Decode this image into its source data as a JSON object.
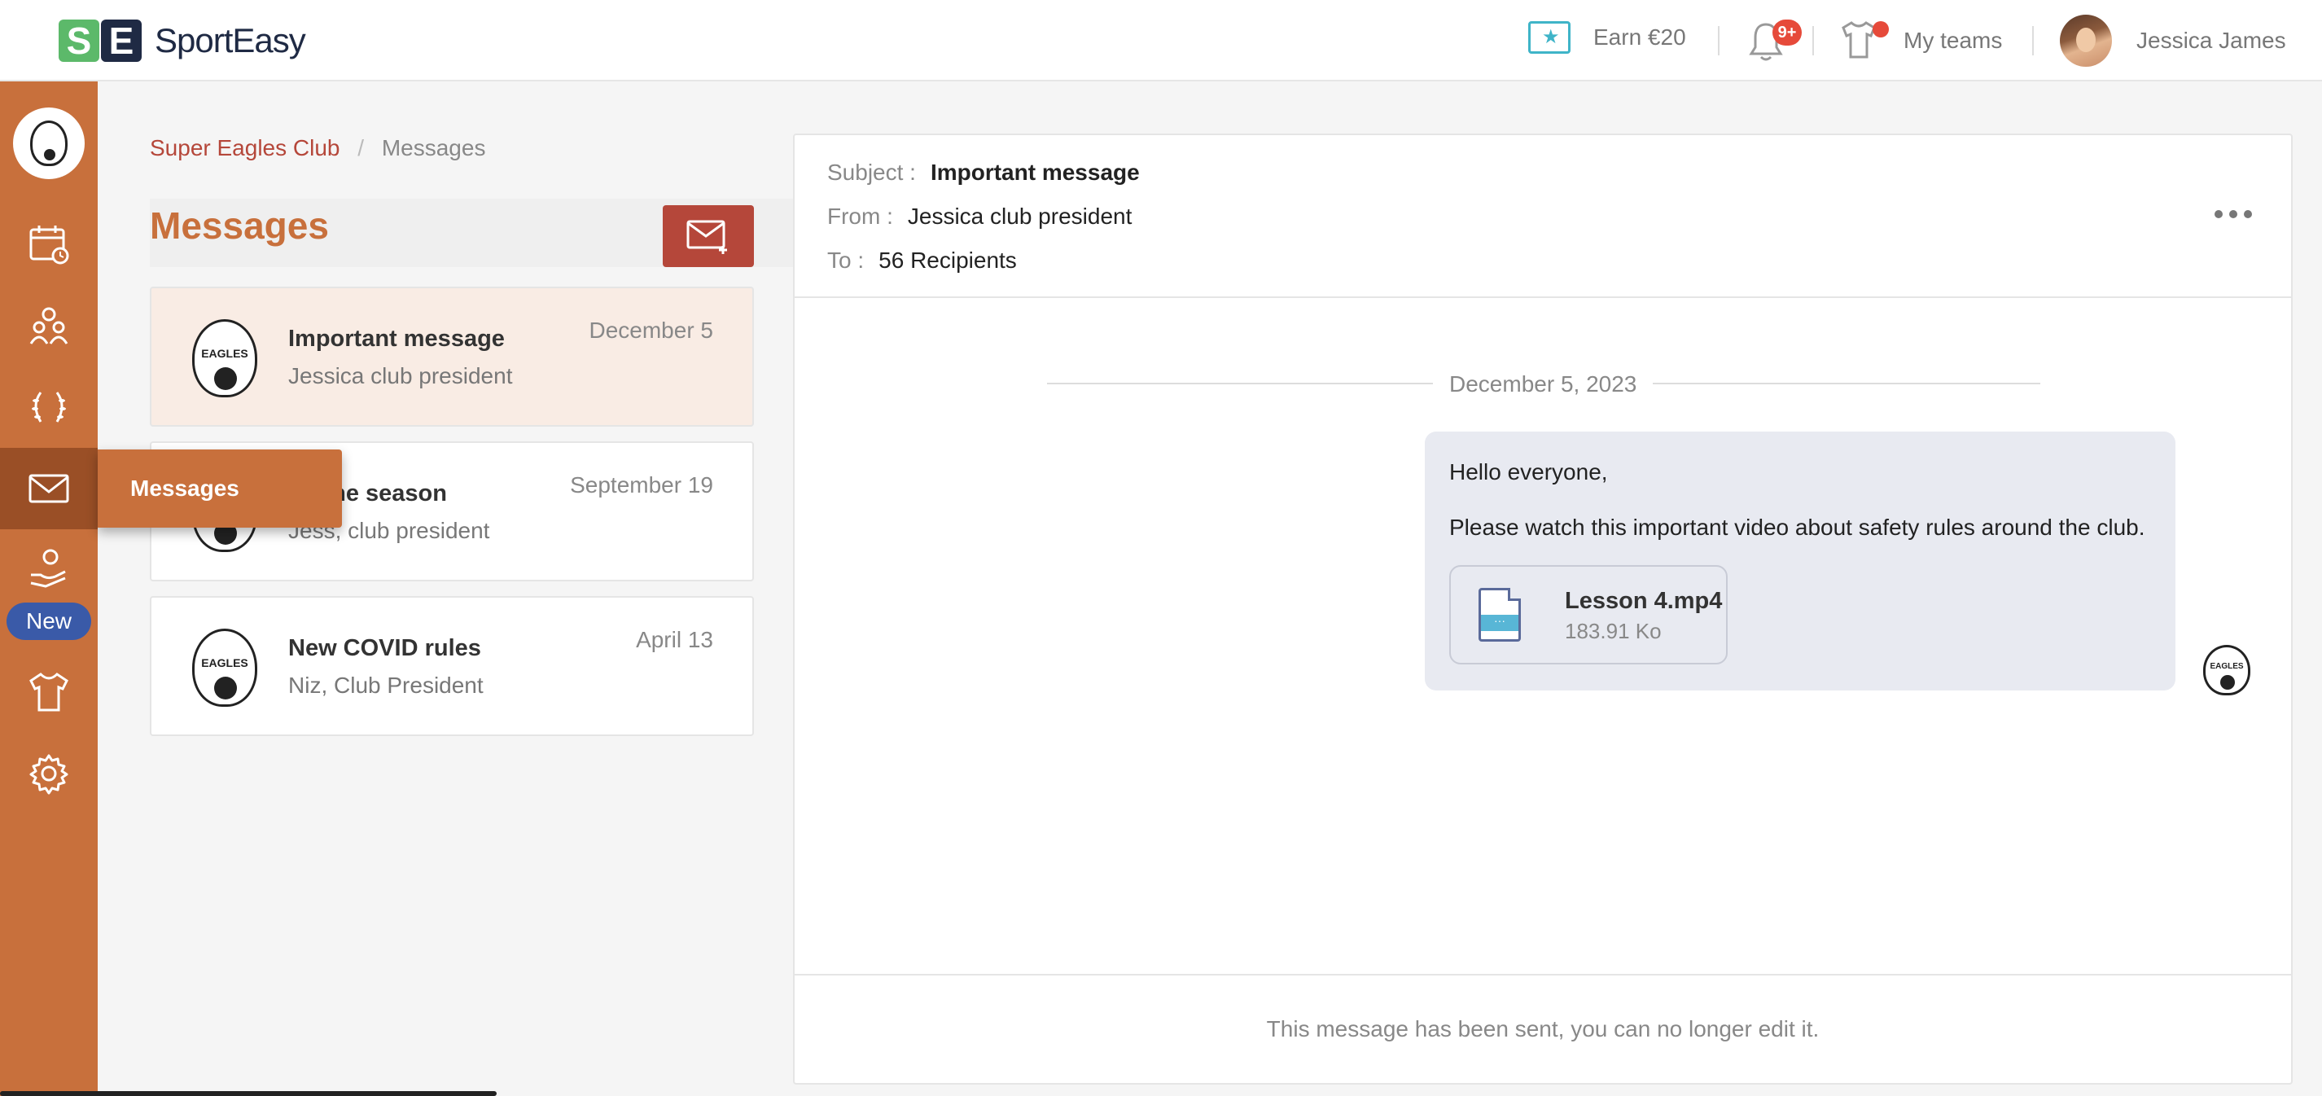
{
  "app": {
    "logo_mark_s": "S",
    "logo_mark_e": "E",
    "name": "SportEasy"
  },
  "topbar": {
    "earn_label": "Earn €20",
    "notification_badge": "9+",
    "my_teams_label": "My teams",
    "user_name": "Jessica James"
  },
  "sidebar": {
    "items": [
      {
        "icon": "calendar-icon"
      },
      {
        "icon": "members-icon"
      },
      {
        "icon": "laurel-icon"
      },
      {
        "icon": "envelope-icon",
        "active": true
      },
      {
        "icon": "hand-heart-icon",
        "badge": "New"
      },
      {
        "icon": "shirt-icon"
      },
      {
        "icon": "gear-icon"
      }
    ],
    "tooltip": "Messages"
  },
  "breadcrumb": {
    "club": "Super Eagles Club",
    "separator": "/",
    "current": "Messages"
  },
  "messages": {
    "title": "Messages",
    "crest_text": "EAGLES",
    "list": [
      {
        "title": "Important message",
        "from": "Jessica club president",
        "date": "December 5"
      },
      {
        "title": "ng the season",
        "from": "Jess, club president",
        "date": "September 19"
      },
      {
        "title": "New COVID rules",
        "from": "Niz, Club President",
        "date": "April 13"
      }
    ]
  },
  "detail": {
    "subject_key": "Subject :",
    "subject": "Important message",
    "from_key": "From :",
    "from": "Jessica club president",
    "to_key": "To :",
    "to": "56 Recipients",
    "date": "December 5, 2023",
    "greeting": "Hello everyone,",
    "body": "Please watch this important video about safety rules around the club.",
    "attachment": {
      "name": "Lesson 4.mp4",
      "size": "183.91 Ko",
      "icon_glyph": "···"
    },
    "footer": "This message has been sent, you can no longer edit it."
  },
  "colors": {
    "accent": "#c8703c",
    "danger": "#b5473a",
    "new_badge": "#3a5aa8",
    "teal": "#3fb4c8"
  }
}
